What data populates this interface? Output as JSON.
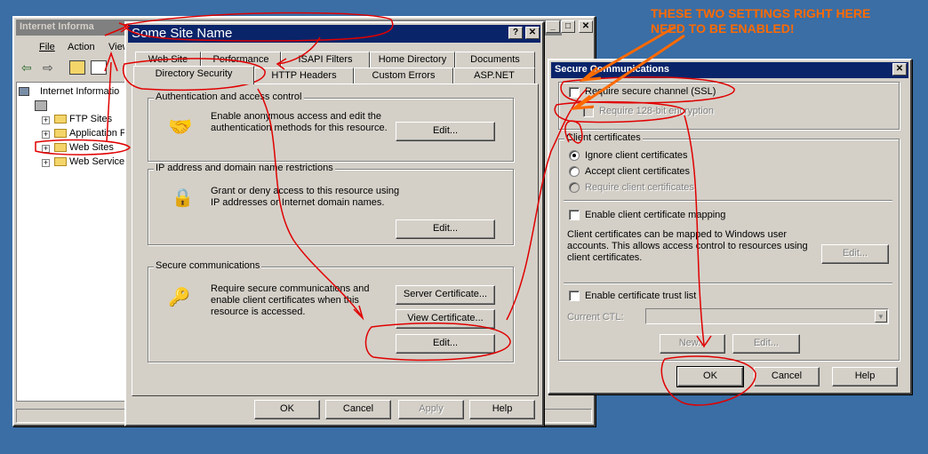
{
  "iis_window": {
    "title": "Internet Informa",
    "menu": [
      "File",
      "Action",
      "View"
    ],
    "tree": {
      "root": "Internet Informatio",
      "items": [
        "FTP Sites",
        "Application F",
        "Web Sites",
        "Web Service"
      ]
    }
  },
  "props_dialog": {
    "title": "Some Site Name",
    "tabs_row1": [
      "Web Site",
      "Performance",
      "ISAPI Filters",
      "Home Directory",
      "Documents"
    ],
    "tabs_row2": [
      "Directory Security",
      "HTTP Headers",
      "Custom Errors",
      "ASP.NET"
    ],
    "auth": {
      "label": "Authentication and access control",
      "desc": "Enable anonymous access and edit the\nauthentication methods for this resource.",
      "edit": "Edit..."
    },
    "ip": {
      "label": "IP address and domain name restrictions",
      "desc": "Grant or deny access to this resource using\nIP addresses or Internet domain names.",
      "edit": "Edit..."
    },
    "secure": {
      "label": "Secure communications",
      "desc": "Require secure communications and\nenable client certificates when this\nresource is accessed.",
      "server_cert": "Server Certificate...",
      "view_cert": "View Certificate...",
      "edit": "Edit..."
    },
    "buttons": {
      "ok": "OK",
      "cancel": "Cancel",
      "apply": "Apply",
      "help": "Help"
    }
  },
  "secure_dialog": {
    "title": "Secure Communications",
    "require_ssl": "Require secure channel (SSL)",
    "require_128": "Require 128-bit encryption",
    "client_certs_label": "Client certificates",
    "ignore": "Ignore client certificates",
    "accept": "Accept client certificates",
    "require": "Require client certificates",
    "enable_mapping": "Enable client certificate mapping",
    "mapping_desc": "Client certificates can be mapped to Windows user\naccounts.  This allows access control to resources using\nclient certificates.",
    "mapping_edit": "Edit...",
    "enable_trust": "Enable certificate trust list",
    "current_ctl": "Current CTL:",
    "new": "New...",
    "edit": "Edit...",
    "ok": "OK",
    "cancel": "Cancel",
    "help": "Help"
  },
  "annotation": "THESE TWO SETTINGS RIGHT HERE\nNEED TO BE ENABLED!",
  "colors": {
    "titlebar_active": "#0a246a",
    "dialog_face": "#d4d0c8",
    "desktop": "#3a6ea5",
    "annotation": "#ff6a00",
    "markup": "#e00000"
  }
}
